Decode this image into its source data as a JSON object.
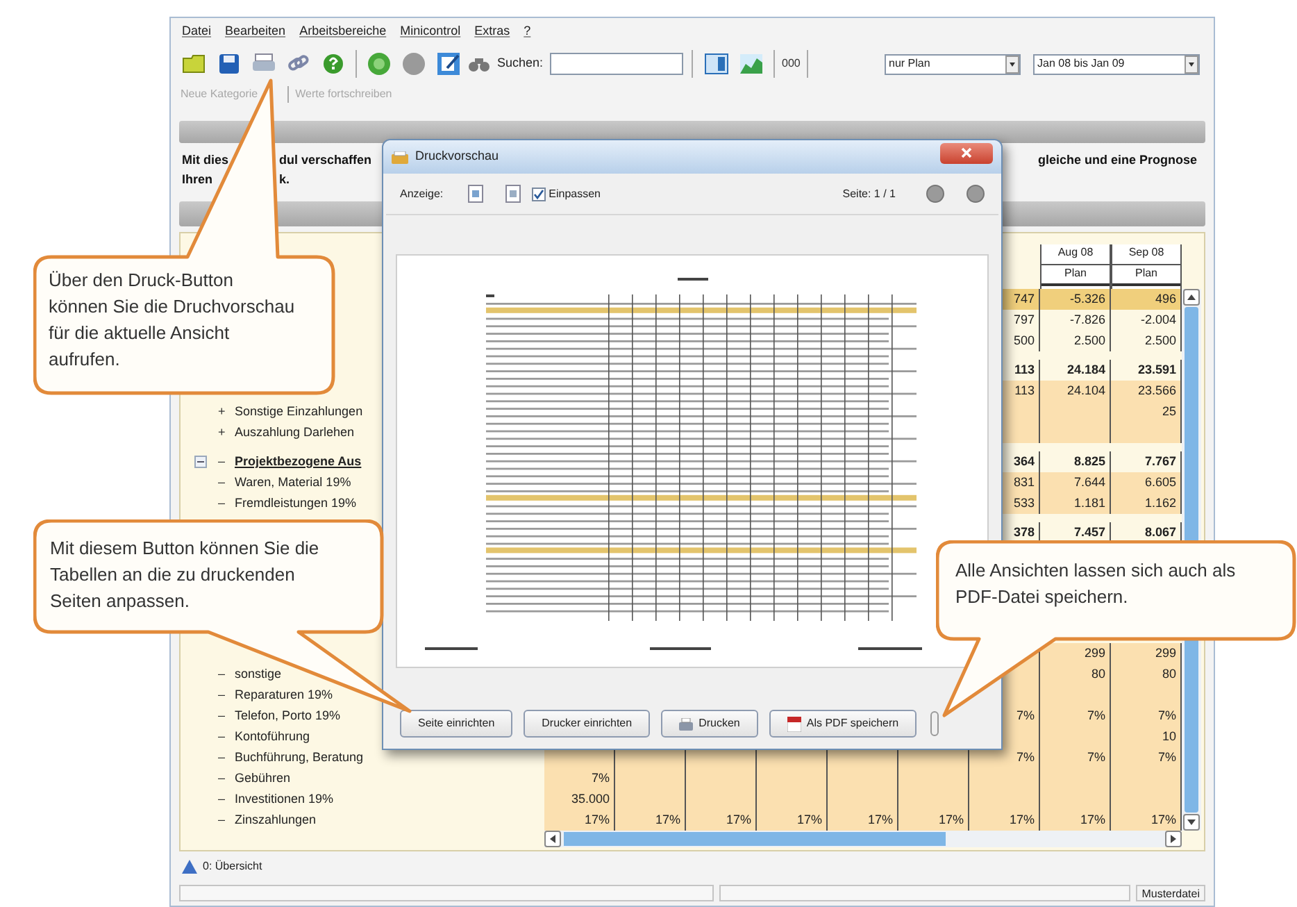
{
  "menu": [
    "Datei",
    "Bearbeiten",
    "Arbeitsbereiche",
    "Minicontrol",
    "Extras",
    "?"
  ],
  "toolbar": {
    "search_label": "Suchen:",
    "counter": "000",
    "filter": "nur Plan",
    "period": "Jan 08 bis Jan 09"
  },
  "subtoolbar": [
    {
      "label": "Neue Kategorie",
      "disabled": true
    },
    {
      "label": "Werte fortschreiben",
      "disabled": true
    }
  ],
  "description": {
    "left": "Mit dies",
    "left_after": "dul verschaffen",
    "left_2": "Ihren",
    "left_2_after": "k.",
    "right": "gleiche und eine Prognose"
  },
  "table": {
    "columns": [
      null,
      null,
      null,
      null,
      null,
      null,
      null,
      {
        "month": "Aug 08",
        "type": "Plan"
      },
      {
        "month": "Sep 08",
        "type": "Plan"
      }
    ],
    "upper_rows": [
      {
        "kind": "item",
        "bold": false,
        "color": "#f0cf7c",
        "cells": [
          null,
          null,
          null,
          null,
          null,
          null,
          "747",
          "-5.326",
          "496"
        ]
      },
      {
        "kind": "item",
        "bold": false,
        "cells": [
          null,
          null,
          null,
          null,
          null,
          null,
          "797",
          "-7.826",
          "-2.004"
        ]
      },
      {
        "kind": "item",
        "bold": false,
        "cells": [
          null,
          null,
          null,
          null,
          null,
          null,
          "500",
          "2.500",
          "2.500"
        ]
      },
      {
        "kind": "item",
        "bold": true,
        "cells": [
          null,
          null,
          null,
          null,
          null,
          null,
          "113",
          "24.184",
          "23.591"
        ]
      },
      {
        "kind": "item",
        "bold": false,
        "color": "#fbe0b0",
        "cells": [
          null,
          null,
          null,
          null,
          null,
          null,
          "113",
          "24.104",
          "23.566"
        ]
      },
      {
        "kind": "item",
        "bold": false,
        "marker": "+",
        "label": "Sonstige Einzahlungen",
        "color": "#fbe0b0",
        "cells": [
          null,
          null,
          null,
          null,
          null,
          null,
          null,
          null,
          "25"
        ]
      },
      {
        "kind": "item",
        "bold": false,
        "marker": "+",
        "label": "Auszahlung Darlehen",
        "color": "#fbe0b0"
      },
      {
        "kind": "group",
        "bold": true,
        "marker": "–",
        "label": "Projektbezogene Aus",
        "cells": [
          null,
          null,
          null,
          null,
          null,
          null,
          "364",
          "8.825",
          "7.767"
        ]
      },
      {
        "kind": "item",
        "bold": false,
        "marker": "–",
        "label": "Waren, Material 19%",
        "color": "#fbe0b0",
        "cells": [
          null,
          null,
          null,
          null,
          null,
          null,
          "831",
          "7.644",
          "6.605"
        ]
      },
      {
        "kind": "item",
        "bold": false,
        "marker": "–",
        "label": "Fremdleistungen 19%",
        "color": "#fbe0b0",
        "cells": [
          null,
          null,
          null,
          null,
          null,
          null,
          "533",
          "1.181",
          "1.162"
        ]
      },
      {
        "kind": "item",
        "bold": true,
        "cells": [
          null,
          null,
          null,
          null,
          null,
          null,
          "378",
          "7.457",
          "8.067"
        ]
      }
    ],
    "lower_rows": [
      {
        "kind": "item",
        "bold": false,
        "color": "#fbe0b0",
        "cells": [
          null,
          null,
          null,
          null,
          null,
          null,
          null,
          "299",
          "299"
        ]
      },
      {
        "kind": "item",
        "bold": false,
        "marker": "–",
        "label": "sonstige",
        "color": "#fbe0b0",
        "cells": [
          null,
          null,
          null,
          null,
          null,
          null,
          null,
          "80",
          "80"
        ]
      },
      {
        "kind": "item",
        "bold": false,
        "marker": "–",
        "label": "Reparaturen 19%",
        "color": "#fbe0b0"
      },
      {
        "kind": "item",
        "bold": false,
        "marker": "–",
        "label": "Telefon, Porto 19%",
        "color": "#fbe0b0",
        "cells": [
          null,
          null,
          null,
          null,
          null,
          null,
          "7%",
          "7%",
          "7%"
        ]
      },
      {
        "kind": "item",
        "bold": false,
        "marker": "–",
        "label": "Kontoführung",
        "color": "#fbe0b0",
        "cells": [
          null,
          null,
          null,
          null,
          null,
          null,
          null,
          null,
          "10"
        ]
      },
      {
        "kind": "item",
        "bold": false,
        "marker": "–",
        "label": "Buchführung, Beratung",
        "color": "#fbe0b0",
        "cells": [
          null,
          null,
          null,
          null,
          null,
          null,
          "7%",
          "7%",
          "7%"
        ]
      },
      {
        "kind": "item",
        "bold": false,
        "marker": "–",
        "label": "Gebühren",
        "color": "#fbe0b0",
        "cells": [
          "7%",
          null,
          null,
          null,
          null,
          null,
          null,
          null,
          null
        ]
      },
      {
        "kind": "item",
        "bold": false,
        "marker": "–",
        "label": "Investitionen 19%",
        "color": "#fbe0b0",
        "cells": [
          "35.000",
          null,
          null,
          null,
          null,
          null,
          null,
          null,
          null
        ]
      },
      {
        "kind": "item",
        "bold": false,
        "marker": "–",
        "label": "Zinszahlungen",
        "color": "#fbe0b0",
        "cells": [
          "17%",
          "17%",
          "17%",
          "17%",
          "17%",
          "17%",
          "17%",
          "17%",
          "17%"
        ]
      }
    ]
  },
  "dialog": {
    "title": "Druckvorschau",
    "display_label": "Anzeige:",
    "fit": {
      "label": "Einpassen",
      "checked": true
    },
    "page": "Seite: 1 / 1",
    "buttons": [
      {
        "label": "Seite einrichten",
        "kind": "plain"
      },
      {
        "label": "Drucker einrichten",
        "kind": "plain"
      },
      {
        "label": "Drucken",
        "kind": "print"
      },
      {
        "label": "Als PDF speichern",
        "kind": "pdf"
      }
    ]
  },
  "callouts": [
    {
      "text": "Über den Druck-Button können Sie die Druchvorschau für die aktuelle Ansicht aufrufen."
    },
    {
      "text": "Mit diesem Button können Sie die Tabellen an die zu druckenden Seiten anpassen."
    },
    {
      "text": "Alle Ansichten lassen sich auch als PDF-Datei speichern."
    }
  ],
  "tab": "0: Übersicht",
  "status": "Musterdatei"
}
